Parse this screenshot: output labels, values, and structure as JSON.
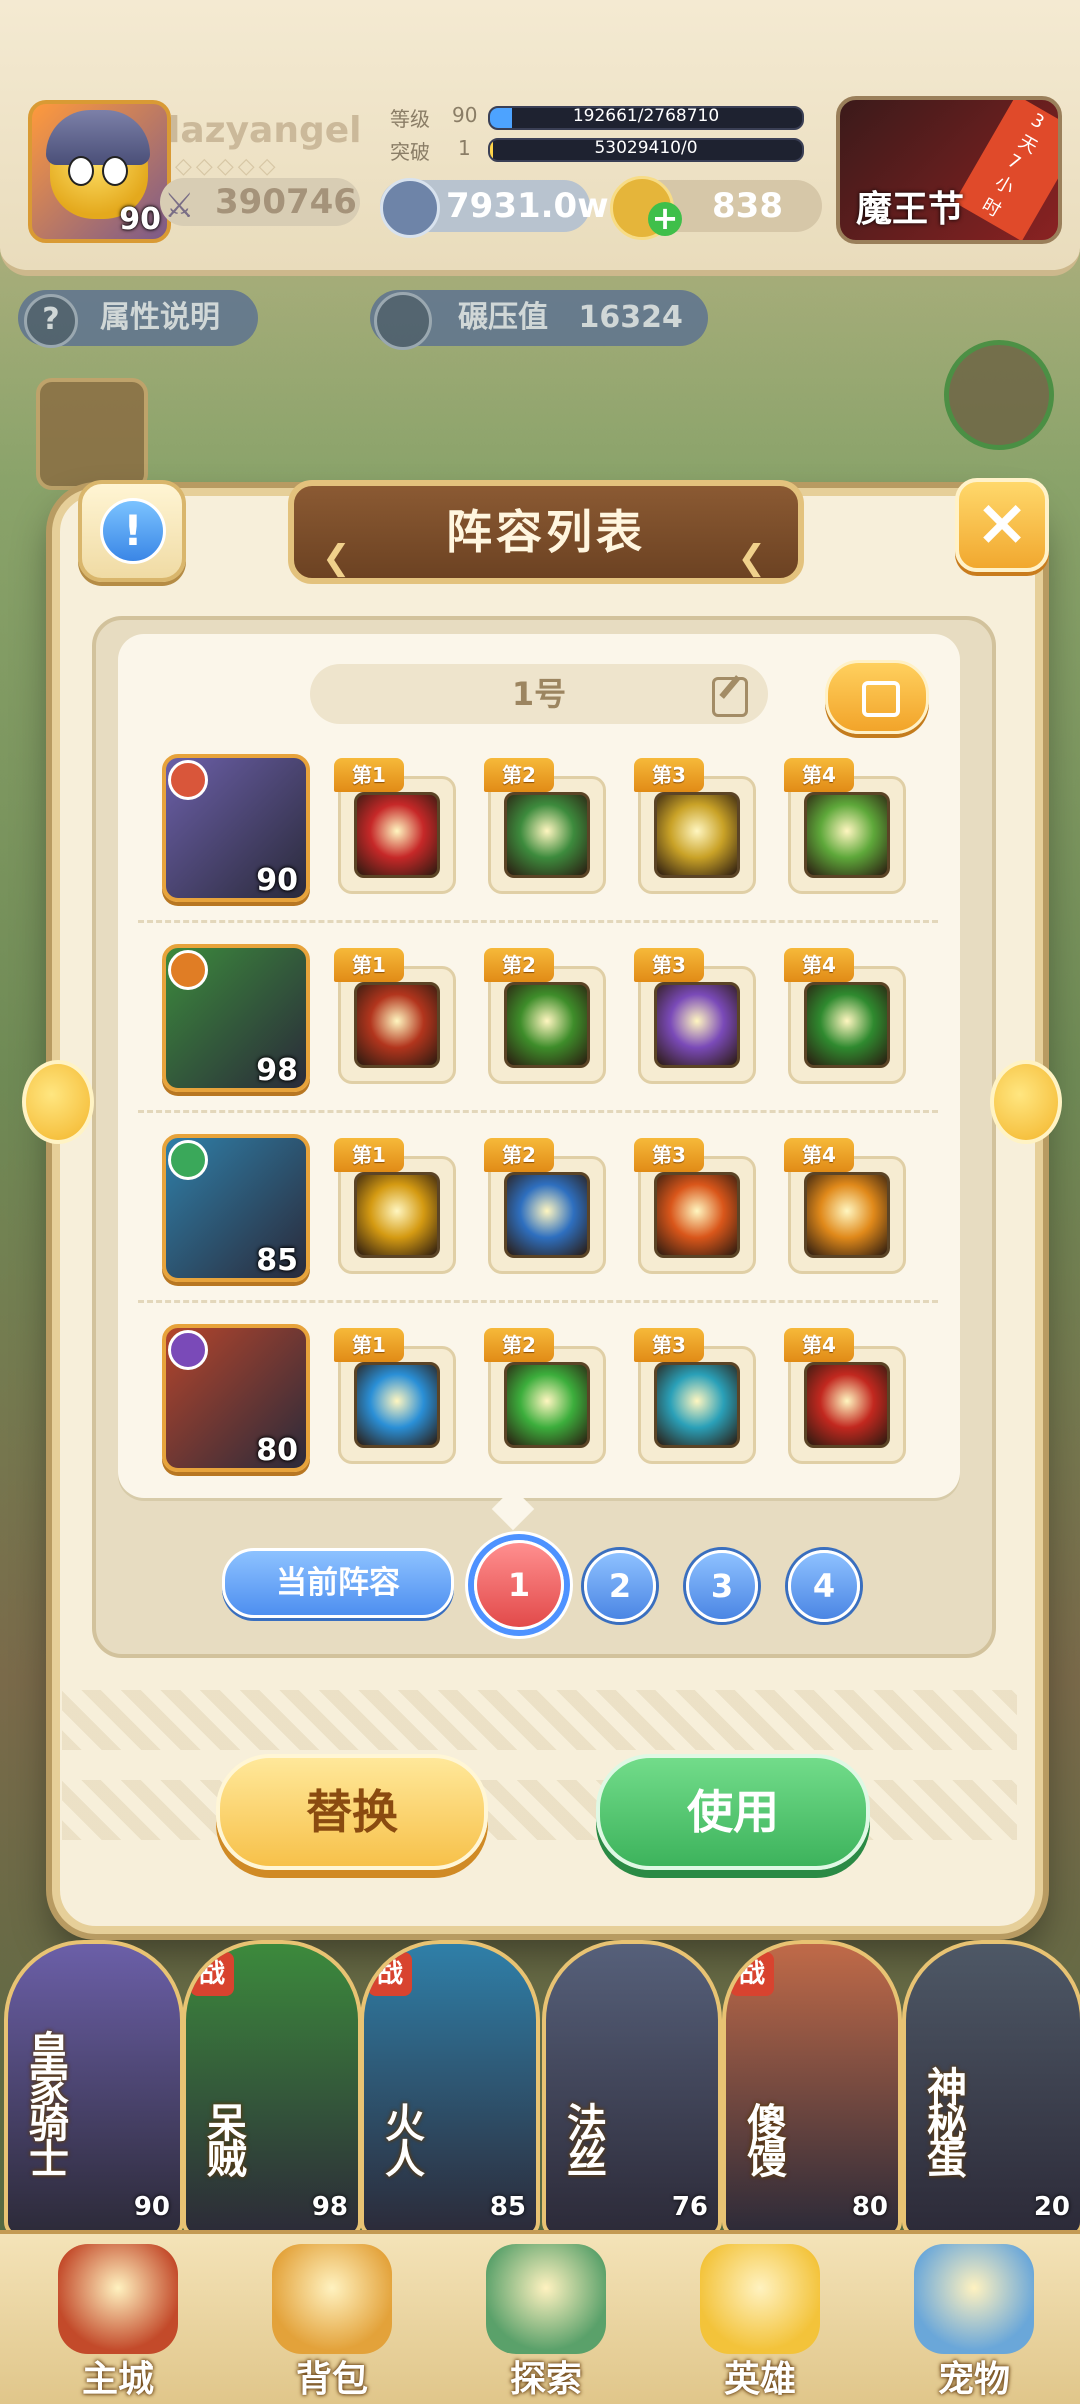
{
  "player": {
    "name": "lazyangel",
    "avatar_level": "90",
    "power": "390746",
    "level_label": "等级",
    "level_value": "90",
    "level_exp": "192661/2768710",
    "level_progress": 0.07,
    "break_label": "突破",
    "break_value": "1",
    "break_exp": "53029410/0",
    "break_progress": 0.01,
    "gold": "7931.0w",
    "gems": "838"
  },
  "event": {
    "label": "魔王节",
    "timer": "3天7小时"
  },
  "sub_hud": {
    "attribute_help": "属性说明",
    "crush_label": "碾压值",
    "crush_value": "16324"
  },
  "dialog": {
    "title": "阵容列表",
    "close_icon": "close-icon",
    "lineup_name": "1号",
    "current_lineup_label": "当前阵容",
    "slots": [
      "1",
      "2",
      "3",
      "4"
    ],
    "active_slot": "1",
    "replace_label": "替换",
    "use_label": "使用"
  },
  "heroes": [
    {
      "level": "90",
      "color": "#6b5fa8",
      "skills": [
        {
          "tag": "第1",
          "color": "#c62828"
        },
        {
          "tag": "第2",
          "color": "#3d8b3d"
        },
        {
          "tag": "第3",
          "color": "#c9a227"
        },
        {
          "tag": "第4",
          "color": "#5ea83a"
        }
      ]
    },
    {
      "level": "98",
      "color": "#3c8a3c",
      "skills": [
        {
          "tag": "第1",
          "color": "#b2351d"
        },
        {
          "tag": "第2",
          "color": "#3e8d2a"
        },
        {
          "tag": "第3",
          "color": "#7a4ab8"
        },
        {
          "tag": "第4",
          "color": "#2f8a2f"
        }
      ]
    },
    {
      "level": "85",
      "color": "#2f7fa8",
      "skills": [
        {
          "tag": "第1",
          "color": "#d49a12"
        },
        {
          "tag": "第2",
          "color": "#2e6fbf"
        },
        {
          "tag": "第3",
          "color": "#d9561a"
        },
        {
          "tag": "第4",
          "color": "#e0891a"
        }
      ]
    },
    {
      "level": "80",
      "color": "#b4452c",
      "skills": [
        {
          "tag": "第1",
          "color": "#2a8fd6"
        },
        {
          "tag": "第2",
          "color": "#3cae3c"
        },
        {
          "tag": "第3",
          "color": "#2aa0b8"
        },
        {
          "tag": "第4",
          "color": "#c2281f"
        }
      ]
    }
  ],
  "roster": [
    {
      "name": "皇家骑士",
      "level": "90",
      "war": "",
      "color": "#6b5fa8"
    },
    {
      "name": "呆贼",
      "level": "98",
      "war": "战",
      "color": "#3c8a3c"
    },
    {
      "name": "火人",
      "level": "85",
      "war": "战",
      "color": "#2f7fa8"
    },
    {
      "name": "法丝",
      "level": "76",
      "war": "",
      "color": "#56607a"
    },
    {
      "name": "傻馒",
      "level": "80",
      "war": "战",
      "color": "#c06a48"
    },
    {
      "name": "神秘蛋",
      "level": "20",
      "war": "",
      "color": "#4e5866"
    }
  ],
  "nav": [
    {
      "label": "主城",
      "color": "#c34a2a"
    },
    {
      "label": "背包",
      "color": "#e3a23a"
    },
    {
      "label": "探索",
      "color": "#5aa16a"
    },
    {
      "label": "英雄",
      "color": "#f3c33a"
    },
    {
      "label": "宠物",
      "color": "#6aa7d9"
    }
  ]
}
